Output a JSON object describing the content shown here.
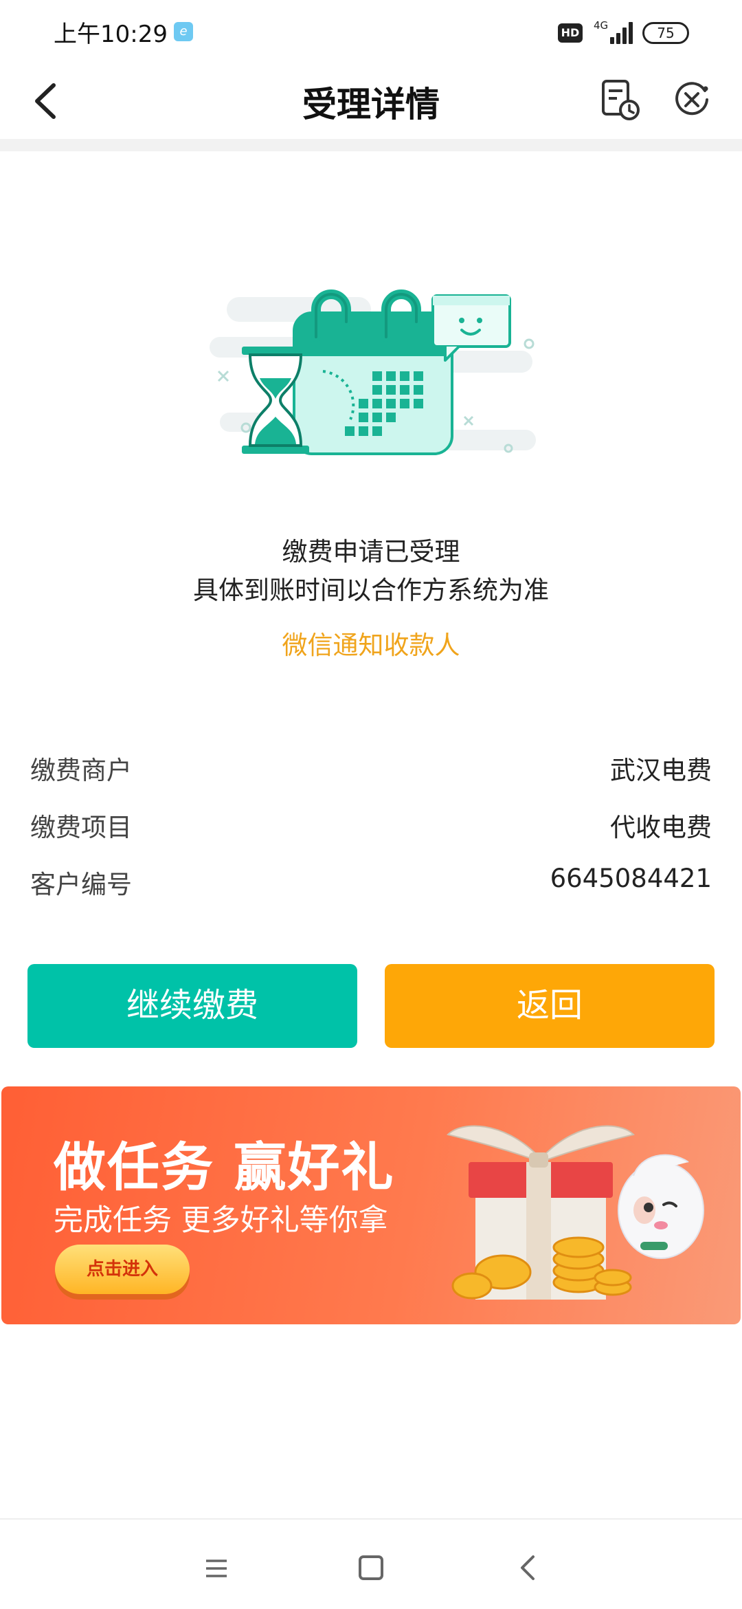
{
  "status_bar": {
    "time": "上午10:29",
    "app_badge": "e",
    "hd": "HD",
    "network": "4G",
    "battery": "75"
  },
  "nav": {
    "title": "受理详情",
    "back_icon": "chevron-left-icon",
    "history_icon": "receipt-clock-icon",
    "close_icon": "close-circle-icon"
  },
  "illustration": {
    "icon": "calendar-hourglass-icon",
    "colors": {
      "primary": "#19b394",
      "light": "#cdf6ee",
      "cloud": "#eef2f3"
    }
  },
  "message": {
    "line1": "缴费申请已受理",
    "line2": "具体到账时间以合作方系统为准",
    "notify_link": "微信通知收款人"
  },
  "details": [
    {
      "label": "缴费商户",
      "value": "武汉电费"
    },
    {
      "label": "缴费项目",
      "value": "代收电费"
    },
    {
      "label": "客户编号",
      "value": "6645084421"
    }
  ],
  "buttons": {
    "continue": "继续缴费",
    "return": "返回"
  },
  "banner": {
    "title": "做任务 赢好礼",
    "subtitle": "完成任务 更多好礼等你拿",
    "cta": "点击进入",
    "art_icon": "gift-box-coins-mascot-icon"
  },
  "system_nav": {
    "menu_icon": "menu-icon",
    "home_icon": "home-square-icon",
    "back_icon": "back-chevron-icon"
  },
  "colors": {
    "accent_green": "#00c2a8",
    "accent_orange": "#fea707",
    "notify_text": "#f0a41c",
    "banner_start": "#ff5f35",
    "banner_end": "#fa9a77"
  }
}
